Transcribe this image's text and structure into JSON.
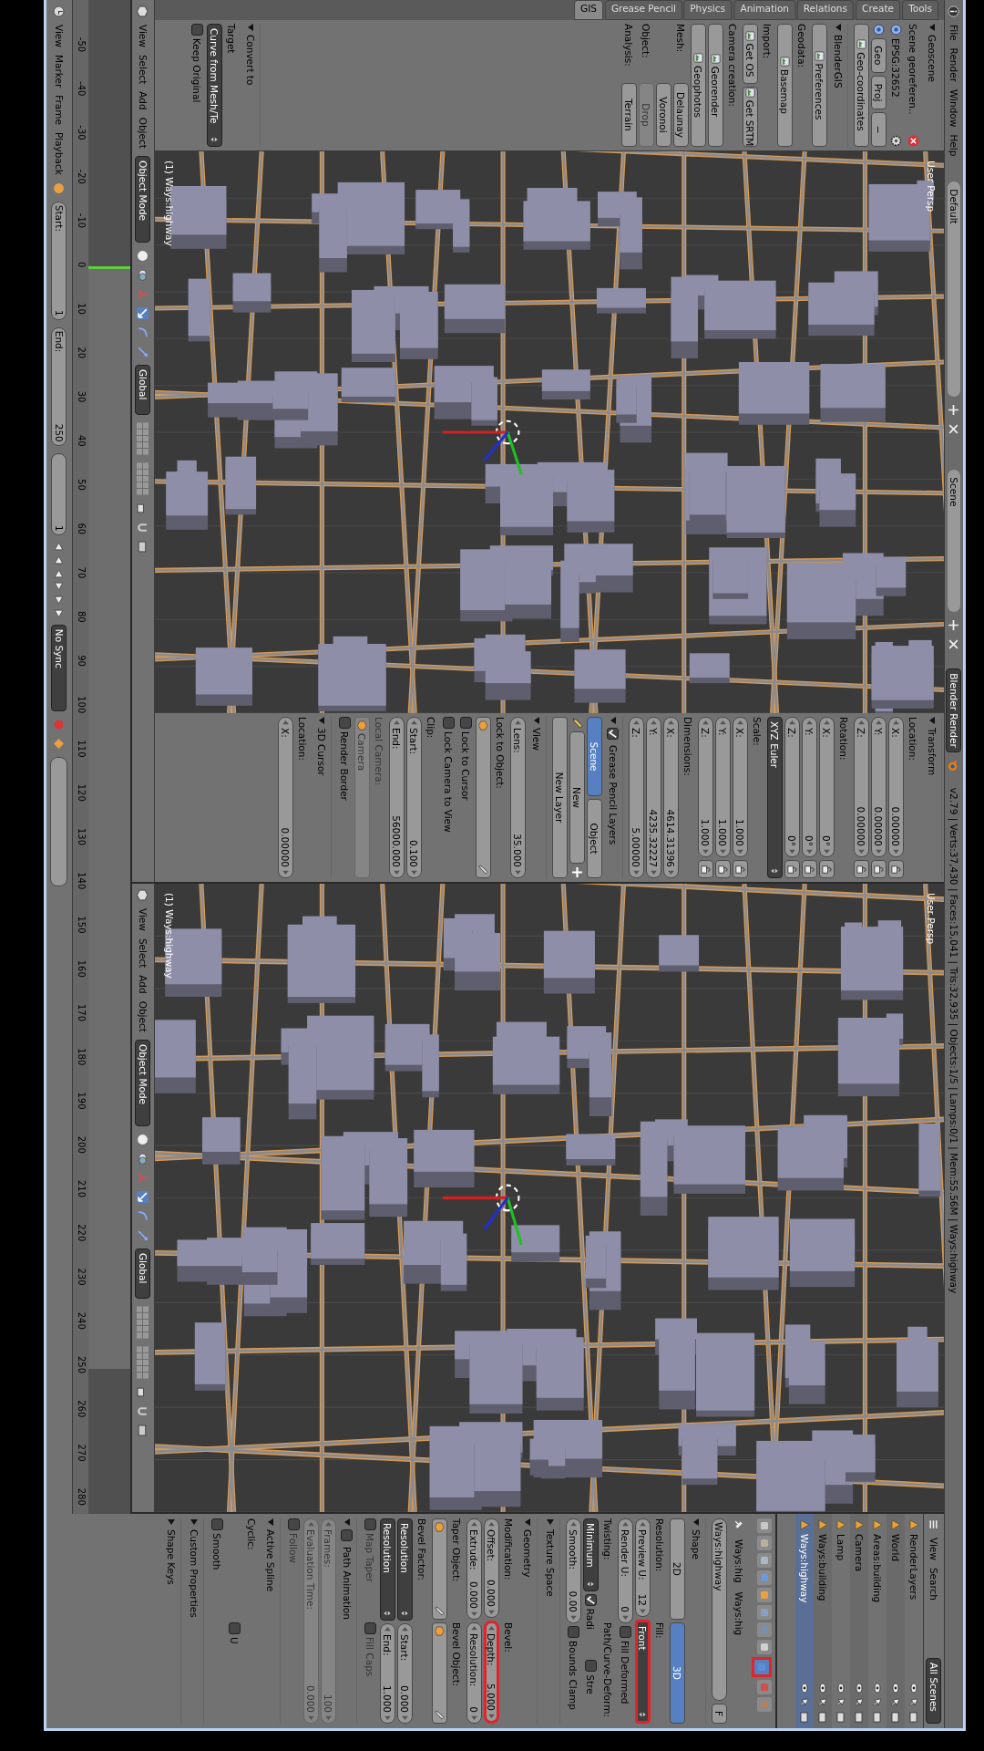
{
  "info_header": {
    "menus": [
      "File",
      "Render",
      "Window",
      "Help"
    ],
    "layout": "Default",
    "scene": "Scene",
    "engine": "Blender Render",
    "stats": "v2.79 | Verts:37,430 | Faces:15,041 | Tris:32,935 | Objects:1/5 | Lamps:0/1 | Mem:55.56M | Ways:highway"
  },
  "viewports": [
    {
      "label": "User Persp",
      "object": "(1) Ways:highway",
      "header": {
        "menus": [
          "View",
          "Select",
          "Add",
          "Object"
        ],
        "mode": "Object Mode",
        "orientation": "Global"
      },
      "toolshelf": {
        "tabs": [
          {
            "label": "GIS",
            "selected": true
          },
          {
            "label": "Grease Pencil",
            "selected": false
          },
          {
            "label": "Physics",
            "selected": false
          },
          {
            "label": "Animation",
            "selected": false
          },
          {
            "label": "Relations",
            "selected": false
          },
          {
            "label": "Create",
            "selected": false
          },
          {
            "label": "Tools",
            "selected": false
          }
        ],
        "panels": [
          {
            "title": "Geoscene",
            "rows": [
              {
                "items": [
                  {
                    "kind": "label",
                    "text": "Scene georeferen.."
                  },
                  {
                    "kind": "remove"
                  }
                ]
              },
              {
                "items": [
                  {
                    "kind": "radio",
                    "selected": true
                  },
                  {
                    "kind": "label",
                    "text": "EPSG:32652"
                  },
                  {
                    "kind": "gear"
                  }
                ]
              },
              {
                "items": [
                  {
                    "kind": "radio",
                    "selected": true
                  },
                  {
                    "kind": "button",
                    "text": "Geo"
                  },
                  {
                    "kind": "button",
                    "text": "Proj"
                  },
                  {
                    "kind": "button",
                    "text": "−"
                  }
                ]
              },
              {
                "items": [
                  {
                    "kind": "icon_button",
                    "text": "Geo-coordinates"
                  }
                ]
              }
            ]
          },
          {
            "title": "BlenderGIS",
            "rows": [
              {
                "items": [
                  {
                    "kind": "icon_button",
                    "text": "Preferences"
                  }
                ]
              },
              {
                "items": [
                  {
                    "kind": "label",
                    "text": "Geodata:"
                  }
                ]
              },
              {
                "items": [
                  {
                    "kind": "icon_button",
                    "text": "Basemap"
                  }
                ]
              },
              {
                "items": [
                  {
                    "kind": "label",
                    "text": "Import:"
                  }
                ]
              },
              {
                "items": [
                  {
                    "kind": "icon_button",
                    "text": "Get OS"
                  },
                  {
                    "kind": "icon_button",
                    "text": "Get SRTM"
                  }
                ]
              },
              {
                "items": [
                  {
                    "kind": "label",
                    "text": "Camera creation:"
                  }
                ]
              },
              {
                "items": [
                  {
                    "kind": "icon_button",
                    "text": "Georender"
                  }
                ]
              },
              {
                "items": [
                  {
                    "kind": "icon_button",
                    "text": "Geophotos"
                  }
                ]
              },
              {
                "items": [
                  {
                    "kind": "label",
                    "text": "Mesh:"
                  },
                  {
                    "kind": "button",
                    "text": "Delaunay"
                  }
                ]
              },
              {
                "items": [
                  {
                    "kind": "spacer"
                  },
                  {
                    "kind": "button",
                    "text": "Voronoi"
                  }
                ]
              },
              {
                "items": [
                  {
                    "kind": "label",
                    "text": "Object:"
                  },
                  {
                    "kind": "button",
                    "text": "Drop",
                    "disabled": true
                  }
                ]
              },
              {
                "items": [
                  {
                    "kind": "label",
                    "text": "Analysis:"
                  },
                  {
                    "kind": "button",
                    "text": "Terrain"
                  }
                ]
              }
            ]
          }
        ],
        "redo": {
          "title": "Convert to",
          "rows": [
            {
              "items": [
                {
                  "kind": "label",
                  "text": "Target"
                }
              ]
            },
            {
              "items": [
                {
                  "kind": "dropdown",
                  "text": "Curve from Mesh/Te"
                }
              ]
            },
            {
              "items": [
                {
                  "kind": "checkbox",
                  "text": "Keep Original",
                  "checked": false
                }
              ]
            }
          ]
        }
      },
      "n_panel": [
        {
          "title": "Transform",
          "rows": [
            {
              "items": [
                {
                  "kind": "label",
                  "text": "Location:"
                }
              ]
            },
            {
              "items": [
                {
                  "kind": "field",
                  "label": "X:",
                  "value": "0.00000"
                },
                {
                  "kind": "lock"
                }
              ]
            },
            {
              "items": [
                {
                  "kind": "field",
                  "label": "Y:",
                  "value": "0.00000"
                },
                {
                  "kind": "lock"
                }
              ]
            },
            {
              "items": [
                {
                  "kind": "field",
                  "label": "Z:",
                  "value": "0.00000"
                },
                {
                  "kind": "lock"
                }
              ]
            },
            {
              "items": [
                {
                  "kind": "label",
                  "text": "Rotation:"
                }
              ]
            },
            {
              "items": [
                {
                  "kind": "field",
                  "label": "X:",
                  "value": "0°"
                },
                {
                  "kind": "lock"
                }
              ]
            },
            {
              "items": [
                {
                  "kind": "field",
                  "label": "Y:",
                  "value": "0°"
                },
                {
                  "kind": "lock"
                }
              ]
            },
            {
              "items": [
                {
                  "kind": "field",
                  "label": "Z:",
                  "value": "0°"
                },
                {
                  "kind": "lock"
                }
              ]
            },
            {
              "items": [
                {
                  "kind": "dropdown",
                  "text": "XYZ Euler"
                }
              ]
            },
            {
              "items": [
                {
                  "kind": "label",
                  "text": "Scale:"
                }
              ]
            },
            {
              "items": [
                {
                  "kind": "field",
                  "label": "X:",
                  "value": "1.000"
                },
                {
                  "kind": "lock"
                }
              ]
            },
            {
              "items": [
                {
                  "kind": "field",
                  "label": "Y:",
                  "value": "1.000"
                },
                {
                  "kind": "lock"
                }
              ]
            },
            {
              "items": [
                {
                  "kind": "field",
                  "label": "Z:",
                  "value": "1.000"
                },
                {
                  "kind": "lock"
                }
              ]
            },
            {
              "items": [
                {
                  "kind": "label",
                  "text": "Dimensions:"
                }
              ]
            },
            {
              "items": [
                {
                  "kind": "field",
                  "label": "X:",
                  "value": "4614.31396"
                }
              ]
            },
            {
              "items": [
                {
                  "kind": "field",
                  "label": "Y:",
                  "value": "4235.32227"
                }
              ]
            },
            {
              "items": [
                {
                  "kind": "field",
                  "label": "Z:",
                  "value": "5.00000"
                }
              ]
            }
          ]
        },
        {
          "title": "Grease Pencil Layers",
          "checkbox": true,
          "rows": [
            {
              "items": [
                {
                  "kind": "toggle",
                  "text": "Scene",
                  "selected": true
                },
                {
                  "kind": "toggle",
                  "text": "Object",
                  "selected": false
                }
              ]
            },
            {
              "items": [
                {
                  "kind": "pencil"
                },
                {
                  "kind": "button",
                  "text": "New"
                },
                {
                  "kind": "add"
                }
              ]
            },
            {
              "items": [
                {
                  "kind": "button",
                  "text": "New Layer"
                }
              ]
            }
          ]
        },
        {
          "title": "View",
          "rows": [
            {
              "items": [
                {
                  "kind": "field",
                  "label": "Lens:",
                  "value": "35.000"
                }
              ]
            },
            {
              "items": [
                {
                  "kind": "label",
                  "text": "Lock to Object:"
                }
              ]
            },
            {
              "items": [
                {
                  "kind": "object_field"
                }
              ]
            },
            {
              "items": [
                {
                  "kind": "checkbox",
                  "text": "Lock to Cursor",
                  "checked": false
                }
              ]
            },
            {
              "items": [
                {
                  "kind": "checkbox",
                  "text": "Lock Camera to View",
                  "checked": false
                }
              ]
            },
            {
              "items": [
                {
                  "kind": "label",
                  "text": "Clip:"
                }
              ]
            },
            {
              "items": [
                {
                  "kind": "field",
                  "label": "Start:",
                  "value": "0.100"
                }
              ]
            },
            {
              "items": [
                {
                  "kind": "field",
                  "label": "End:",
                  "value": "56000.000"
                }
              ]
            },
            {
              "items": [
                {
                  "kind": "label",
                  "text": "Local Camera:",
                  "disabled": true
                }
              ]
            },
            {
              "items": [
                {
                  "kind": "object_field",
                  "text": "Camera",
                  "disabled": true
                }
              ]
            },
            {
              "items": [
                {
                  "kind": "checkbox",
                  "text": "Render Border",
                  "checked": false
                }
              ]
            }
          ]
        },
        {
          "title": "3D Cursor",
          "rows": [
            {
              "items": [
                {
                  "kind": "label",
                  "text": "Location:"
                }
              ]
            },
            {
              "items": [
                {
                  "kind": "field",
                  "label": "X:",
                  "value": "0.00000"
                }
              ]
            }
          ]
        }
      ]
    },
    {
      "label": "User Persp",
      "object": "(1) Ways:highway",
      "header": {
        "menus": [
          "View",
          "Select",
          "Add",
          "Object"
        ],
        "mode": "Object Mode",
        "orientation": "Global"
      }
    }
  ],
  "timeline": {
    "menus": [
      "View",
      "Marker",
      "Frame",
      "Playback"
    ],
    "start": {
      "label": "Start:",
      "value": "1"
    },
    "end": {
      "label": "End:",
      "value": "250"
    },
    "current": "1",
    "sync": "No Sync",
    "ticks": [
      "-50",
      "-40",
      "-30",
      "-20",
      "-10",
      "0",
      "10",
      "20",
      "30",
      "40",
      "50",
      "60",
      "70",
      "80",
      "90",
      "100",
      "110",
      "120",
      "130",
      "140",
      "150",
      "160",
      "170",
      "180",
      "190",
      "200",
      "210",
      "220",
      "230",
      "240",
      "250",
      "260",
      "270",
      "280"
    ]
  },
  "outliner": {
    "menus": [
      "View",
      "Search"
    ],
    "filter": "All Scenes",
    "rows": [
      {
        "name": "RenderLayers",
        "selected": false
      },
      {
        "name": "World",
        "selected": false
      },
      {
        "name": "Areas:building",
        "selected": false
      },
      {
        "name": "Camera",
        "selected": false
      },
      {
        "name": "Lamp",
        "selected": false
      },
      {
        "name": "Ways:building",
        "selected": false
      },
      {
        "name": "Ways:highway",
        "selected": true
      }
    ]
  },
  "properties": {
    "context_tabs": [
      {
        "selected": false,
        "highlighted": false
      },
      {
        "selected": false,
        "highlighted": false
      },
      {
        "selected": false,
        "highlighted": false
      },
      {
        "selected": false,
        "highlighted": false
      },
      {
        "selected": false,
        "highlighted": false
      },
      {
        "selected": false,
        "highlighted": false
      },
      {
        "selected": false,
        "highlighted": false
      },
      {
        "selected": false,
        "highlighted": false
      },
      {
        "selected": true,
        "highlighted": true
      },
      {
        "selected": false,
        "highlighted": false
      },
      {
        "selected": false,
        "highlighted": false
      }
    ],
    "context": [
      "Ways:hig",
      "Ways:hig"
    ],
    "datablock": {
      "name": "Ways:highway",
      "users": "F"
    },
    "panels": [
      {
        "title": "Shape",
        "rows": [
          {
            "items": [
              {
                "kind": "toggle",
                "text": "2D",
                "selected": false
              },
              {
                "kind": "toggle",
                "text": "3D",
                "selected": true
              }
            ]
          },
          {
            "items": [
              {
                "kind": "label",
                "text": "Resolution:"
              },
              {
                "kind": "label",
                "text": "Fill:"
              }
            ]
          },
          {
            "items": [
              {
                "kind": "field",
                "label": "Preview U:",
                "value": "12"
              },
              {
                "kind": "dropdown",
                "text": "Front",
                "highlighted": true
              }
            ]
          },
          {
            "items": [
              {
                "kind": "field",
                "label": "Render U:",
                "value": "0"
              },
              {
                "kind": "checkbox",
                "text": "Fill Deformed",
                "checked": false
              }
            ]
          },
          {
            "items": [
              {
                "kind": "label",
                "text": "Twisting:"
              },
              {
                "kind": "label",
                "text": "Path/Curve-Deform:"
              }
            ]
          },
          {
            "items": [
              {
                "kind": "dropdown",
                "text": "Minimum"
              },
              {
                "kind": "checkbox",
                "text": "Radi",
                "checked": true
              },
              {
                "kind": "checkbox",
                "text": "Stre",
                "checked": false
              }
            ]
          },
          {
            "items": [
              {
                "kind": "field",
                "label": "Smooth:",
                "value": "0.00"
              },
              {
                "kind": "checkbox",
                "text": "Bounds Clamp",
                "checked": false
              }
            ]
          }
        ]
      },
      {
        "title": "Texture Space"
      },
      {
        "title": "Geometry",
        "rows": [
          {
            "items": [
              {
                "kind": "label",
                "text": "Modification:"
              },
              {
                "kind": "label",
                "text": "Bevel:"
              }
            ]
          },
          {
            "items": [
              {
                "kind": "field",
                "label": "Offset:",
                "value": "0.000"
              },
              {
                "kind": "field",
                "label": "Depth:",
                "value": "5.000",
                "highlighted": true
              }
            ]
          },
          {
            "items": [
              {
                "kind": "field",
                "label": "Extrude:",
                "value": "0.000"
              },
              {
                "kind": "field",
                "label": "Resolution:",
                "value": "0"
              }
            ]
          },
          {
            "items": [
              {
                "kind": "label",
                "text": "Taper Object:"
              },
              {
                "kind": "label",
                "text": "Bevel Object:"
              }
            ]
          },
          {
            "items": [
              {
                "kind": "object_field"
              },
              {
                "kind": "object_field"
              }
            ]
          },
          {
            "items": [
              {
                "kind": "label",
                "text": "Bevel Factor:"
              },
              {
                "kind": "spacer"
              }
            ]
          },
          {
            "items": [
              {
                "kind": "dropdown",
                "text": "Resolution"
              },
              {
                "kind": "field",
                "label": "Start:",
                "value": "0.000"
              }
            ]
          },
          {
            "items": [
              {
                "kind": "dropdown",
                "text": "Resolution"
              },
              {
                "kind": "field",
                "label": "End:",
                "value": "1.000"
              }
            ]
          },
          {
            "items": [
              {
                "kind": "checkbox",
                "text": "Map Taper",
                "checked": false,
                "disabled": true
              },
              {
                "kind": "checkbox",
                "text": "Fill Caps",
                "checked": false,
                "disabled": true
              }
            ]
          }
        ]
      },
      {
        "title": "Path Animation",
        "checkbox": false,
        "rows": [
          {
            "items": [
              {
                "kind": "field",
                "label": "Frames:",
                "value": "100",
                "disabled": true
              }
            ]
          },
          {
            "items": [
              {
                "kind": "field",
                "label": "Evaluation Time:",
                "value": "0.000",
                "disabled": true
              }
            ]
          },
          {
            "items": [
              {
                "kind": "checkbox",
                "text": "Follow",
                "checked": false,
                "disabled": true
              }
            ]
          }
        ]
      },
      {
        "title": "Active Spline",
        "rows": [
          {
            "items": [
              {
                "kind": "label",
                "text": "Cyclic:"
              },
              {
                "kind": "spacer"
              }
            ]
          },
          {
            "items": [
              {
                "kind": "spacer"
              },
              {
                "kind": "checkbox",
                "text": "U",
                "checked": false
              }
            ]
          },
          {
            "items": [
              {
                "kind": "checkbox",
                "text": "Smooth",
                "checked": false
              },
              {
                "kind": "spacer"
              }
            ]
          }
        ]
      },
      {
        "title": "Custom Properties"
      },
      {
        "title": "Shape Keys"
      }
    ]
  }
}
